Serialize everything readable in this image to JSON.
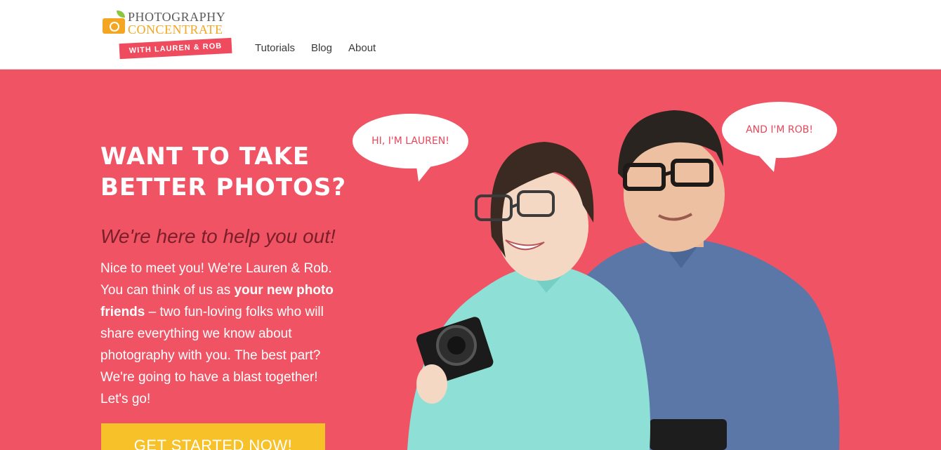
{
  "header": {
    "logo": {
      "line1": "PHOTOGRAPHY",
      "line2": "CONCENTRATE",
      "ribbon": "WITH LAUREN & ROB"
    },
    "nav": [
      {
        "label": "Tutorials"
      },
      {
        "label": "Blog"
      },
      {
        "label": "About"
      }
    ]
  },
  "hero": {
    "headline_line1": "WANT TO TAKE",
    "headline_line2": "BETTER PHOTOS?",
    "tagline": "We're here to help you out!",
    "intro": {
      "part1": "Nice to meet you! We're Lauren & Rob. You can think of us as ",
      "bold": "your new photo friends",
      "part2": " – two fun-loving folks who will share everything we know about photography with you. The best part? We're going to have a blast together! Let's go!"
    },
    "cta_label": "GET STARTED NOW!",
    "bubbles": {
      "lauren": "HI, I'M LAUREN!",
      "rob": "AND I'M ROB!"
    }
  },
  "colors": {
    "hero_bg": "#f05464",
    "cta_bg": "#f7c12a",
    "logo_orange": "#f4a623",
    "logo_ribbon": "#ee4b5e"
  }
}
